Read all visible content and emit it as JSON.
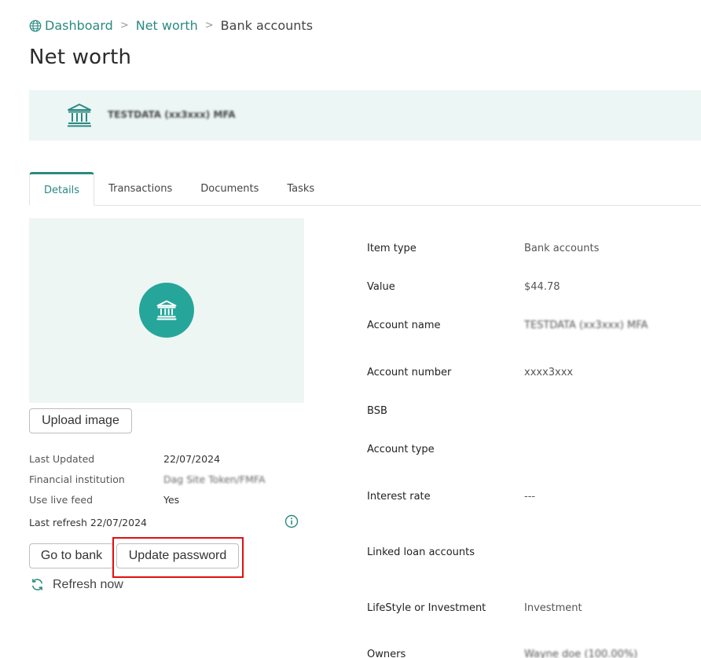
{
  "breadcrumb": {
    "items": [
      "Dashboard",
      "Net worth"
    ],
    "current": "Bank accounts",
    "separator": ">"
  },
  "page": {
    "title": "Net worth"
  },
  "banner": {
    "title": "TESTDATA (xx3xxx) MFA",
    "icon": "bank-icon"
  },
  "tabs": [
    {
      "label": "Details",
      "active": true
    },
    {
      "label": "Transactions",
      "active": false
    },
    {
      "label": "Documents",
      "active": false
    },
    {
      "label": "Tasks",
      "active": false
    }
  ],
  "left": {
    "upload_label": "Upload image",
    "meta": [
      {
        "label": "Last Updated",
        "value": "22/07/2024"
      },
      {
        "label": "Financial institution",
        "value": "Dag Site Token/FMFA"
      },
      {
        "label": "Use live feed",
        "value": "Yes"
      }
    ],
    "last_refresh": "Last refresh 22/07/2024",
    "go_bank_label": "Go to bank",
    "update_password_label": "Update password",
    "refresh_label": "Refresh now"
  },
  "details": [
    {
      "label": "Item type",
      "value": "Bank accounts"
    },
    {
      "label": "Value",
      "value": "$44.78"
    },
    {
      "label": "Account name",
      "value": "TESTDATA (xx3xxx) MFA"
    },
    {
      "label": "Account number",
      "value": "xxxx3xxx"
    },
    {
      "label": "BSB",
      "value": ""
    },
    {
      "label": "Account type",
      "value": ""
    },
    {
      "label": "Interest rate",
      "value": "---"
    },
    {
      "label": "Linked loan accounts",
      "value": ""
    },
    {
      "label": "LifeStyle or Investment",
      "value": "Investment"
    },
    {
      "label": "Owners",
      "value": "Wayne doe (100.00%)"
    }
  ],
  "colors": {
    "accent": "#2a8a82",
    "teal_circle": "#26a69a",
    "banner_bg": "#ecf6f4",
    "highlight": "#e01010"
  }
}
